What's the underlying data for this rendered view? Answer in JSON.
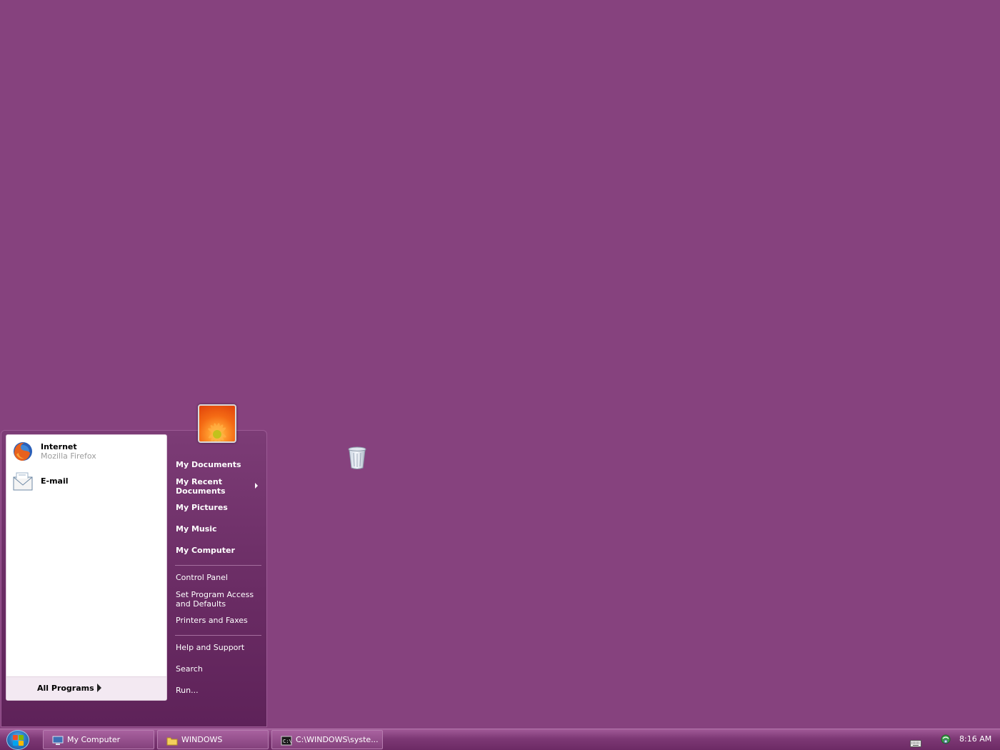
{
  "desktop": {
    "background_color": "#86427e",
    "recycle_bin_icon": "recycle-bin-icon"
  },
  "start_menu": {
    "user_picture_icon": "flower-user-picture",
    "pinned": [
      {
        "title": "Internet",
        "subtitle": "Mozilla Firefox",
        "icon": "firefox-icon"
      },
      {
        "title": "E-mail",
        "subtitle": "",
        "icon": "email-envelope-icon"
      }
    ],
    "all_programs_label": "All Programs",
    "right_items": {
      "my_documents": "My Documents",
      "my_recent_documents_line1": "My Recent",
      "my_recent_documents_line2": "Documents",
      "my_pictures": "My Pictures",
      "my_music": "My Music",
      "my_computer": "My Computer",
      "control_panel": "Control Panel",
      "set_program_access_line1": "Set Program Access",
      "set_program_access_line2": "and Defaults",
      "printers_and_faxes": "Printers and Faxes",
      "help_and_support": "Help and Support",
      "search": "Search",
      "run": "Run..."
    }
  },
  "taskbar": {
    "start_button_icon": "windows-logo-icon",
    "tasks": [
      {
        "label": "My Computer",
        "icon": "computer-icon"
      },
      {
        "label": "WINDOWS",
        "icon": "folder-icon"
      },
      {
        "label": "C:\\WINDOWS\\syste...",
        "icon": "command-prompt-icon"
      }
    ],
    "tray": {
      "keyboard_icon": "keyboard-icon",
      "network_icon": "network-icon",
      "clock": "8:16 AM"
    }
  }
}
